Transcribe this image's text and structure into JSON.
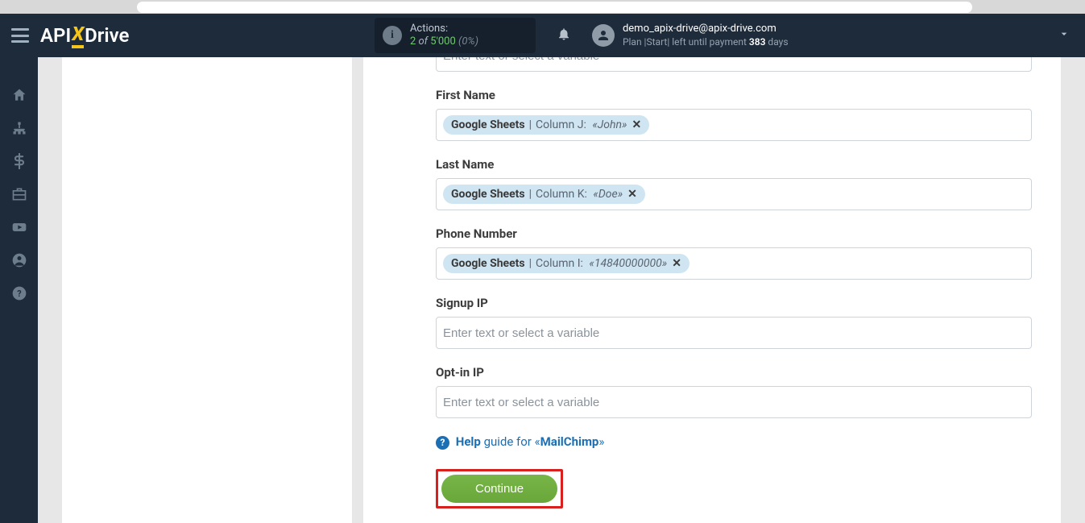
{
  "header": {
    "logo": {
      "part1": "API",
      "part2": "X",
      "part3": "Drive"
    },
    "actions": {
      "label": "Actions:",
      "count": "2",
      "of": "of",
      "limit": "5'000",
      "pct": "(0%)"
    },
    "user": {
      "email": "demo_apix-drive@apix-drive.com",
      "plan_prefix": "Plan |Start| left until payment ",
      "plan_days": "383",
      "plan_suffix": " days"
    }
  },
  "sidebar": {
    "items": [
      {
        "name": "home-icon"
      },
      {
        "name": "sitemap-icon"
      },
      {
        "name": "dollar-icon"
      },
      {
        "name": "briefcase-icon"
      },
      {
        "name": "youtube-icon"
      },
      {
        "name": "user-icon"
      },
      {
        "name": "help-icon"
      }
    ]
  },
  "form": {
    "placeholder": "Enter text or select a variable",
    "fields": [
      {
        "label": "",
        "chip": null
      },
      {
        "label": "First Name",
        "chip": {
          "source": "Google Sheets",
          "column": "Column J:",
          "value": "«John»"
        }
      },
      {
        "label": "Last Name",
        "chip": {
          "source": "Google Sheets",
          "column": "Column K:",
          "value": "«Doe»"
        }
      },
      {
        "label": "Phone Number",
        "chip": {
          "source": "Google Sheets",
          "column": "Column I:",
          "value": "«14840000000»"
        }
      },
      {
        "label": "Signup IP",
        "chip": null
      },
      {
        "label": "Opt-in IP",
        "chip": null
      }
    ],
    "help": {
      "help": "Help",
      "guide": " guide for «",
      "service": "MailChimp",
      "close": "»"
    },
    "continue": "Continue"
  }
}
